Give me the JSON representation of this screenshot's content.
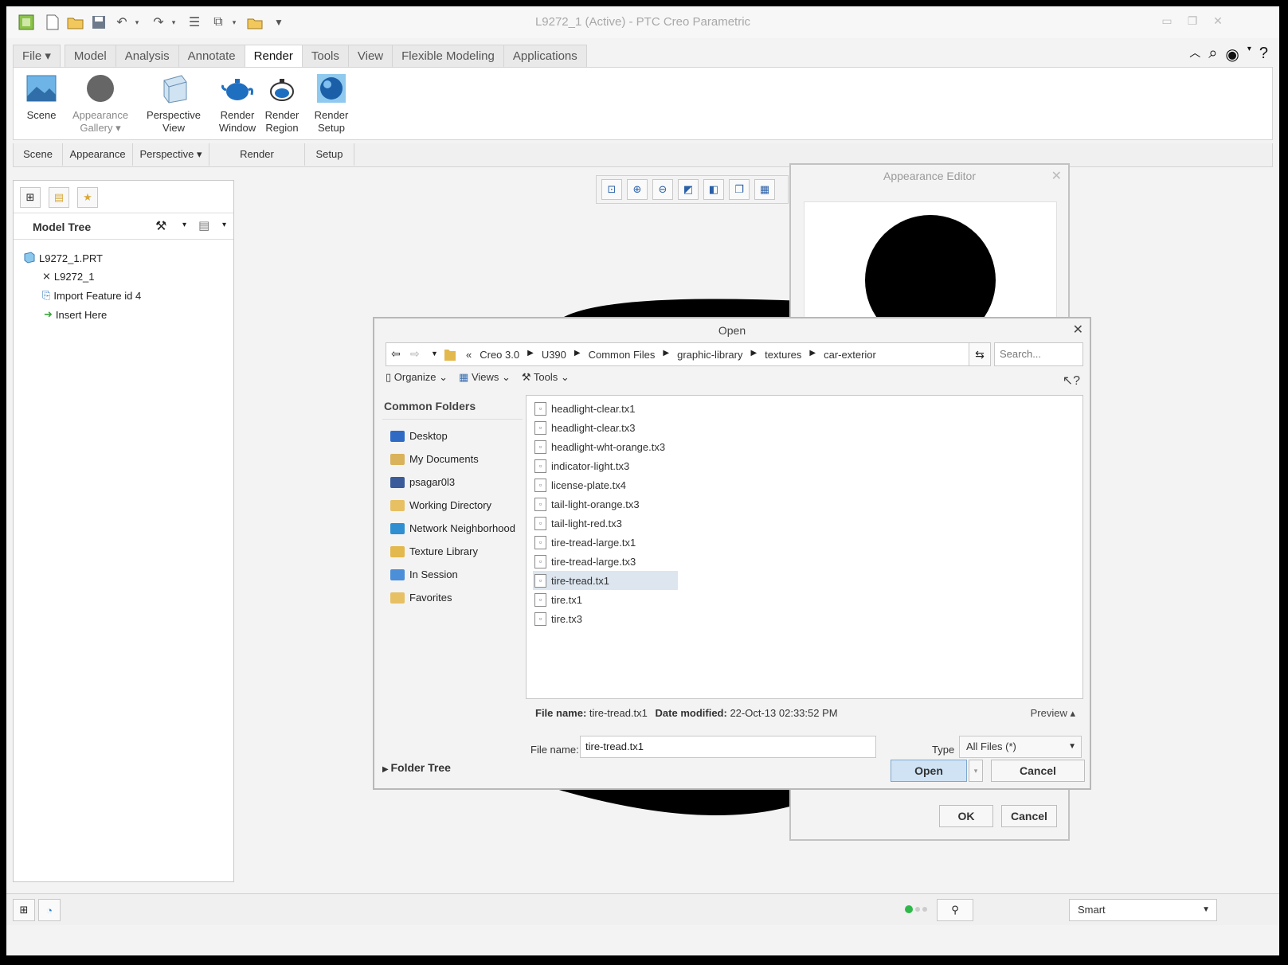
{
  "window": {
    "title": "L9272_1 (Active) - PTC Creo Parametric",
    "minimize": "▭",
    "restore": "❐",
    "close": "✕"
  },
  "ribbon": {
    "tabs": [
      {
        "label": "File ▾"
      },
      {
        "label": "Model"
      },
      {
        "label": "Analysis"
      },
      {
        "label": "Annotate"
      },
      {
        "label": "Render"
      },
      {
        "label": "Tools"
      },
      {
        "label": "View"
      },
      {
        "label": "Flexible Modeling"
      },
      {
        "label": "Applications"
      }
    ],
    "active_tab": "Render",
    "buttons": {
      "scene": "Scene",
      "appearance_gallery_1": "Appearance",
      "appearance_gallery_2": "Gallery ▾",
      "perspective_1": "Perspective",
      "perspective_2": "View",
      "render_window_1": "Render",
      "render_window_2": "Window",
      "render_region_1": "Render",
      "render_region_2": "Region",
      "render_setup_1": "Render",
      "render_setup_2": "Setup"
    },
    "groups": {
      "scene": "Scene",
      "appearance": "Appearance",
      "perspective": "Perspective ▾",
      "render": "Render",
      "setup": "Setup"
    }
  },
  "model_tree": {
    "title": "Model Tree",
    "items": [
      {
        "label": "L9272_1.PRT"
      },
      {
        "label": "L9272_1"
      },
      {
        "label": "Import Feature id 4"
      },
      {
        "label": "Insert Here"
      }
    ]
  },
  "appearance_editor": {
    "title": "Appearance Editor",
    "ok": "OK",
    "cancel": "Cancel"
  },
  "open_dialog": {
    "title": "Open",
    "breadcrumbs": [
      "«",
      "Creo 3.0",
      "U390",
      "Common Files",
      "graphic-library",
      "textures",
      "car-exterior"
    ],
    "search_placeholder": "Search...",
    "toolbar": {
      "organize": "Organize ⌄",
      "views": "Views ⌄",
      "tools": "Tools ⌄"
    },
    "common_folders_title": "Common Folders",
    "common_folders": [
      {
        "label": "Desktop",
        "color": "#2f6bc4"
      },
      {
        "label": "My Documents",
        "color": "#d9b25a"
      },
      {
        "label": "psagar0l3",
        "color": "#3a5a9a"
      },
      {
        "label": "Working Directory",
        "color": "#e6c063"
      },
      {
        "label": "Network Neighborhood",
        "color": "#2f8fd0"
      },
      {
        "label": "Texture Library",
        "color": "#e3b84c"
      },
      {
        "label": "In Session",
        "color": "#4a8fd8"
      },
      {
        "label": "Favorites",
        "color": "#e6c063"
      }
    ],
    "files": [
      {
        "name": "headlight-clear.tx1"
      },
      {
        "name": "headlight-clear.tx3"
      },
      {
        "name": "headlight-wht-orange.tx3"
      },
      {
        "name": "indicator-light.tx3"
      },
      {
        "name": "license-plate.tx4"
      },
      {
        "name": "tail-light-orange.tx3"
      },
      {
        "name": "tail-light-red.tx3"
      },
      {
        "name": "tire-tread-large.tx1"
      },
      {
        "name": "tire-tread-large.tx3"
      },
      {
        "name": "tire-tread.tx1"
      },
      {
        "name": "tire.tx1"
      },
      {
        "name": "tire.tx3"
      }
    ],
    "selected_file": "tire-tread.tx1",
    "info": {
      "file_name_label": "File name:",
      "file_name_value": "tire-tread.tx1",
      "date_label": "Date modified:",
      "date_value": "22-Oct-13 02:33:52 PM",
      "preview": "Preview ▴"
    },
    "file_name_field_label": "File name:",
    "file_name_field_value": "tire-tread.tx1",
    "type_label": "Type",
    "type_value": "All Files (*)",
    "folder_tree": "Folder Tree",
    "open_button": "Open",
    "cancel_button": "Cancel"
  },
  "statusbar": {
    "smart_filter": "Smart"
  }
}
